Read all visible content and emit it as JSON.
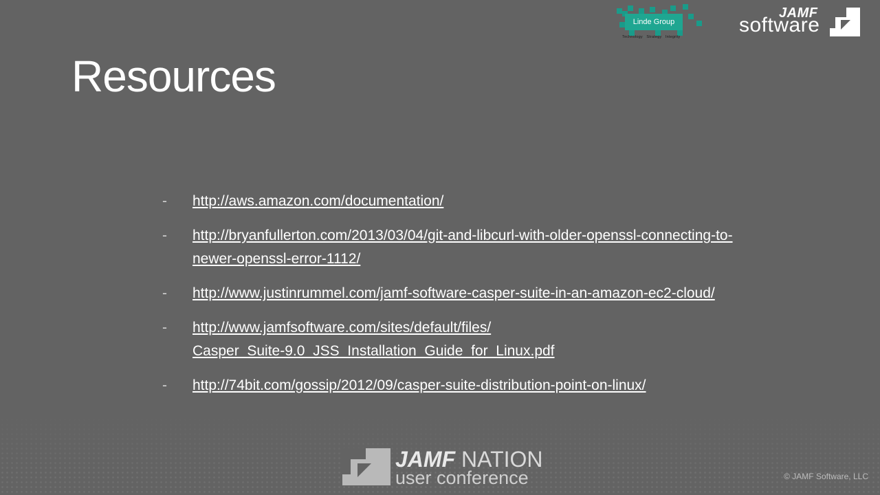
{
  "slide": {
    "title": "Resources",
    "links": [
      {
        "dash": "-",
        "lines": [
          "http://aws.amazon.com/documentation/"
        ]
      },
      {
        "dash": "-",
        "lines": [
          "http://bryanfullerton.com/2013/03/04/git-and-libcurl-with-older-openssl-connecting-to-",
          "newer-openssl-error-1112/"
        ]
      },
      {
        "dash": "-",
        "lines": [
          "http://www.justinrummel.com/jamf-software-casper-suite-in-an-amazon-ec2-cloud/"
        ]
      },
      {
        "dash": "-",
        "lines": [
          "http://www.jamfsoftware.com/sites/default/files/",
          "Casper_Suite-9.0_JSS_Installation_Guide_for_Linux.pdf"
        ]
      },
      {
        "dash": "-",
        "lines": [
          "http://74bit.com/gossip/2012/09/casper-suite-distribution-point-on-linux/"
        ]
      }
    ]
  },
  "logos": {
    "linde": {
      "name": "Linde Group",
      "tagline": [
        "Technology",
        "Strategy",
        "Integrity"
      ]
    },
    "jamf": {
      "word1": "JAMF",
      "word2": "software"
    },
    "conference": {
      "brand_bold": "JAMF",
      "brand_light": "NATION",
      "sub": "user conference"
    }
  },
  "footer": {
    "copyright": "© JAMF Software, LLC"
  },
  "colors": {
    "background": "#636363",
    "linde_teal": "#1fa691",
    "text": "#ffffff"
  }
}
